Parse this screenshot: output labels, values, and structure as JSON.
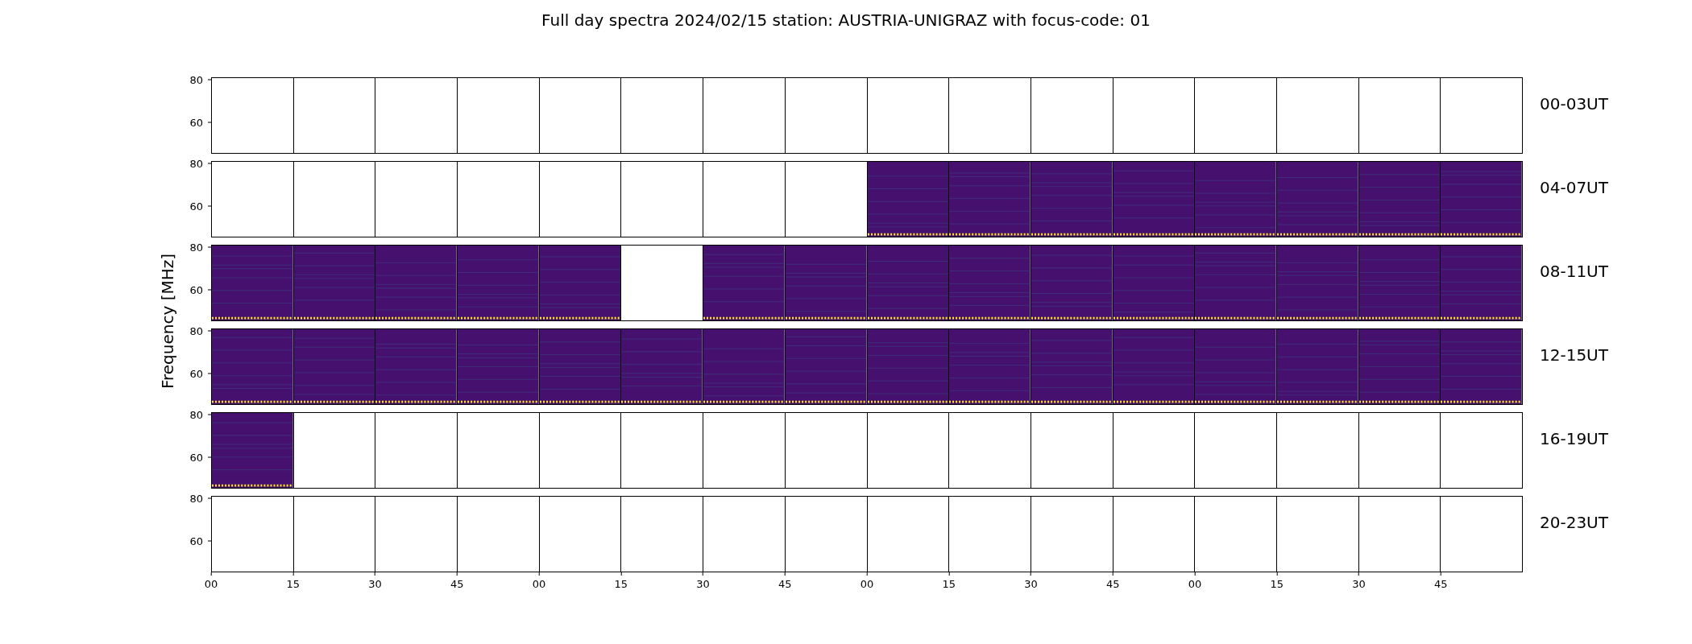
{
  "title": "Full day spectra 2024/02/15 station: AUSTRIA-UNIGRAZ with focus-code: 01",
  "y_axis_label": "Frequency [MHz]",
  "rows": [
    {
      "label": "00-03UT",
      "yticks": [
        "80",
        "60"
      ],
      "panels": [
        {
          "data": false
        },
        {
          "data": false
        },
        {
          "data": false
        },
        {
          "data": false
        },
        {
          "data": false
        },
        {
          "data": false
        },
        {
          "data": false
        },
        {
          "data": false
        },
        {
          "data": false
        },
        {
          "data": false
        },
        {
          "data": false
        },
        {
          "data": false
        },
        {
          "data": false
        },
        {
          "data": false
        },
        {
          "data": false
        },
        {
          "data": false
        }
      ]
    },
    {
      "label": "04-07UT",
      "yticks": [
        "80",
        "60"
      ],
      "panels": [
        {
          "data": false
        },
        {
          "data": false
        },
        {
          "data": false
        },
        {
          "data": false
        },
        {
          "data": false
        },
        {
          "data": false
        },
        {
          "data": false
        },
        {
          "data": false
        },
        {
          "data": true
        },
        {
          "data": true
        },
        {
          "data": true
        },
        {
          "data": true
        },
        {
          "data": true
        },
        {
          "data": true
        },
        {
          "data": true
        },
        {
          "data": true
        }
      ]
    },
    {
      "label": "08-11UT",
      "yticks": [
        "80",
        "60"
      ],
      "panels": [
        {
          "data": true
        },
        {
          "data": true
        },
        {
          "data": true
        },
        {
          "data": true
        },
        {
          "data": true
        },
        {
          "data": false
        },
        {
          "data": true
        },
        {
          "data": true
        },
        {
          "data": true
        },
        {
          "data": true
        },
        {
          "data": true
        },
        {
          "data": true
        },
        {
          "data": true
        },
        {
          "data": true
        },
        {
          "data": true
        },
        {
          "data": true
        }
      ]
    },
    {
      "label": "12-15UT",
      "yticks": [
        "80",
        "60"
      ],
      "panels": [
        {
          "data": true
        },
        {
          "data": true
        },
        {
          "data": true
        },
        {
          "data": true
        },
        {
          "data": true
        },
        {
          "data": true
        },
        {
          "data": true
        },
        {
          "data": true
        },
        {
          "data": true
        },
        {
          "data": true
        },
        {
          "data": true
        },
        {
          "data": true
        },
        {
          "data": true
        },
        {
          "data": true
        },
        {
          "data": true
        },
        {
          "data": true
        }
      ]
    },
    {
      "label": "16-19UT",
      "yticks": [
        "80",
        "60"
      ],
      "panels": [
        {
          "data": true
        },
        {
          "data": false
        },
        {
          "data": false
        },
        {
          "data": false
        },
        {
          "data": false
        },
        {
          "data": false
        },
        {
          "data": false
        },
        {
          "data": false
        },
        {
          "data": false
        },
        {
          "data": false
        },
        {
          "data": false
        },
        {
          "data": false
        },
        {
          "data": false
        },
        {
          "data": false
        },
        {
          "data": false
        },
        {
          "data": false
        }
      ]
    },
    {
      "label": "20-23UT",
      "yticks": [
        "80",
        "60"
      ],
      "panels": [
        {
          "data": false
        },
        {
          "data": false
        },
        {
          "data": false
        },
        {
          "data": false
        },
        {
          "data": false
        },
        {
          "data": false
        },
        {
          "data": false
        },
        {
          "data": false
        },
        {
          "data": false
        },
        {
          "data": false
        },
        {
          "data": false
        },
        {
          "data": false
        },
        {
          "data": false
        },
        {
          "data": false
        },
        {
          "data": false
        },
        {
          "data": false
        }
      ]
    }
  ],
  "xticks": [
    "00",
    "15",
    "30",
    "45",
    "00",
    "15",
    "30",
    "45",
    "00",
    "15",
    "30",
    "45",
    "00",
    "15",
    "30",
    "45"
  ]
}
